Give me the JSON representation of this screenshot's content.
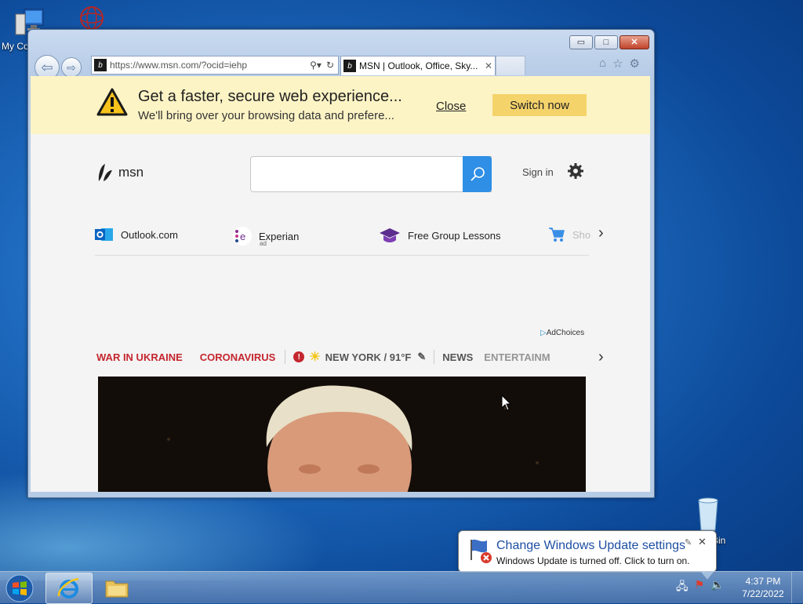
{
  "desktop": {
    "icons": [
      {
        "label": "My Co",
        "icon": "computer-icon"
      },
      {
        "label": "",
        "icon": "network-sphere-icon"
      },
      {
        "label": "Bin",
        "icon": "recycle-bin-icon"
      }
    ]
  },
  "browser": {
    "address": "https://www.msn.com/?ocid=iehp",
    "tab_title": "MSN | Outlook, Office, Sky...",
    "tab_close": "✕",
    "window_buttons": {
      "minimize": "▭",
      "maximize": "□",
      "close": "✕"
    }
  },
  "infobar": {
    "title": "Get a faster, secure web experience...",
    "subtitle": "We'll bring over your browsing data and prefere...",
    "close_label": "Close",
    "switch_label": "Switch now"
  },
  "msn": {
    "logo_text": "msn",
    "search_placeholder": "",
    "signin_label": "Sign in",
    "quicklinks": [
      {
        "label": "Outlook.com",
        "sub": "",
        "icon": "outlook-icon"
      },
      {
        "label": "Experian",
        "sub": "ad",
        "icon": "experian-icon"
      },
      {
        "label": "Free Group Lessons",
        "sub": "",
        "icon": "graduation-cap-icon"
      },
      {
        "label": "Sho",
        "sub": "",
        "icon": "shopping-cart-icon"
      }
    ],
    "adchoices": "AdChoices",
    "categories": {
      "war": "WAR IN UKRAINE",
      "corona": "CORONAVIRUS",
      "weather": "NEW YORK / 91°F",
      "news": "NEWS",
      "entertainment": "ENTERTAINM"
    }
  },
  "notification": {
    "title": "Change Windows Update settings",
    "text": "Windows Update is turned off. Click to turn on.",
    "options_icon": "✎",
    "close": "✕"
  },
  "taskbar": {
    "time": "4:37 PM",
    "date": "7/22/2022"
  }
}
